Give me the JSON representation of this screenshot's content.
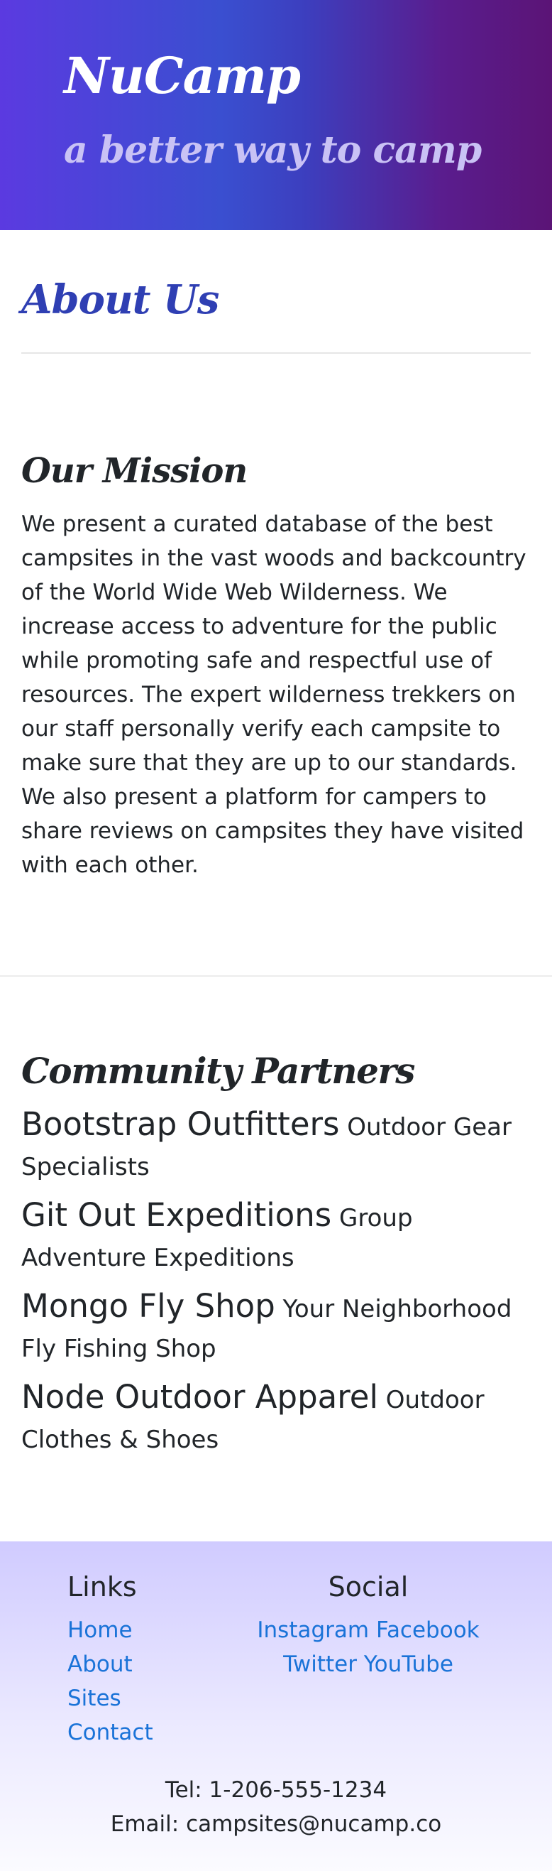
{
  "header": {
    "brand": "NuCamp",
    "tagline": "a better way to camp"
  },
  "about": {
    "title": "About Us"
  },
  "mission": {
    "title": "Our Mission",
    "text": "We present a curated database of the best campsites in the vast woods and backcountry of the World Wide Web Wilderness. We increase access to adventure for the public while promoting safe and respectful use of resources. The expert wilderness trekkers on our staff personally verify each campsite to make sure that they are up to our standards. We also present a platform for campers to share reviews on campsites they have visited with each other."
  },
  "partners": {
    "title": "Community Partners",
    "items": [
      {
        "name": "Bootstrap Outfitters",
        "description": "Outdoor Gear Specialists"
      },
      {
        "name": "Git Out Expeditions",
        "description": "Group Adventure Expeditions"
      },
      {
        "name": "Mongo Fly Shop",
        "description": "Your Neighborhood Fly Fishing Shop"
      },
      {
        "name": "Node Outdoor Apparel",
        "description": "Outdoor Clothes & Shoes"
      }
    ]
  },
  "footer": {
    "links_title": "Links",
    "links": [
      "Home",
      "About",
      "Sites",
      "Contact"
    ],
    "social_title": "Social",
    "social": [
      "Instagram",
      "Facebook",
      "Twitter",
      "YouTube"
    ],
    "tel": "Tel: 1-206-555-1234",
    "email": "Email: campsites@nucamp.co"
  },
  "colors": {
    "header_gradient_start": "#5b3ae0",
    "header_gradient_end": "#5b1476",
    "accent_blue": "#2f3fb3",
    "link_blue": "#1a73d8",
    "footer_bg": "#d0cbff"
  }
}
